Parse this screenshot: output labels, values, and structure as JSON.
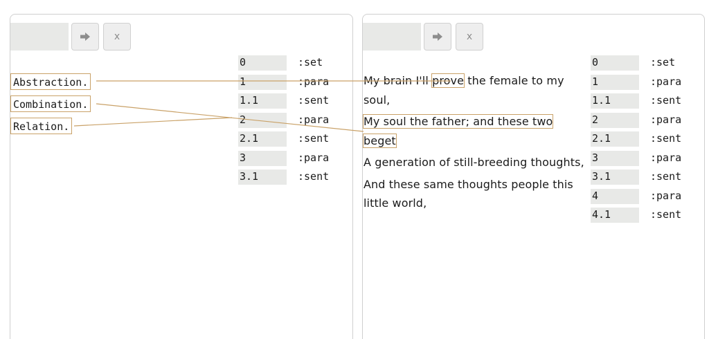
{
  "left": {
    "url_value": "",
    "go_icon": "arrow-right-icon",
    "close_label": "x",
    "words": [
      "Abstraction.",
      "Combination.",
      "Relation."
    ],
    "index": [
      {
        "key": "0",
        "type": ":set"
      },
      {
        "key": "1",
        "type": ":para"
      },
      {
        "key": "1.1",
        "type": ":sent"
      },
      {
        "key": "2",
        "type": ":para"
      },
      {
        "key": "2.1",
        "type": ":sent"
      },
      {
        "key": "3",
        "type": ":para"
      },
      {
        "key": "3.1",
        "type": ":sent"
      }
    ]
  },
  "right": {
    "url_value": "",
    "go_icon": "arrow-right-icon",
    "close_label": "x",
    "poem": [
      {
        "before": "My brain I'll ",
        "highlight": "prove",
        "after": " the female to my soul,"
      },
      {
        "before": "",
        "highlight": "My soul the father; and these two beget",
        "after": ""
      },
      {
        "before": "A generation of still-breeding thoughts,",
        "highlight": "",
        "after": ""
      },
      {
        "before": "And these same thoughts people this little world,",
        "highlight": "",
        "after": ""
      }
    ],
    "index": [
      {
        "key": "0",
        "type": ":set"
      },
      {
        "key": "1",
        "type": ":para"
      },
      {
        "key": "1.1",
        "type": ":sent"
      },
      {
        "key": "2",
        "type": ":para"
      },
      {
        "key": "2.1",
        "type": ":sent"
      },
      {
        "key": "3",
        "type": ":para"
      },
      {
        "key": "3.1",
        "type": ":sent"
      },
      {
        "key": "4",
        "type": ":para"
      },
      {
        "key": "4.1",
        "type": ":sent"
      }
    ]
  },
  "colors": {
    "link": "#c9a167",
    "key_bg": "#e8e9e7"
  }
}
